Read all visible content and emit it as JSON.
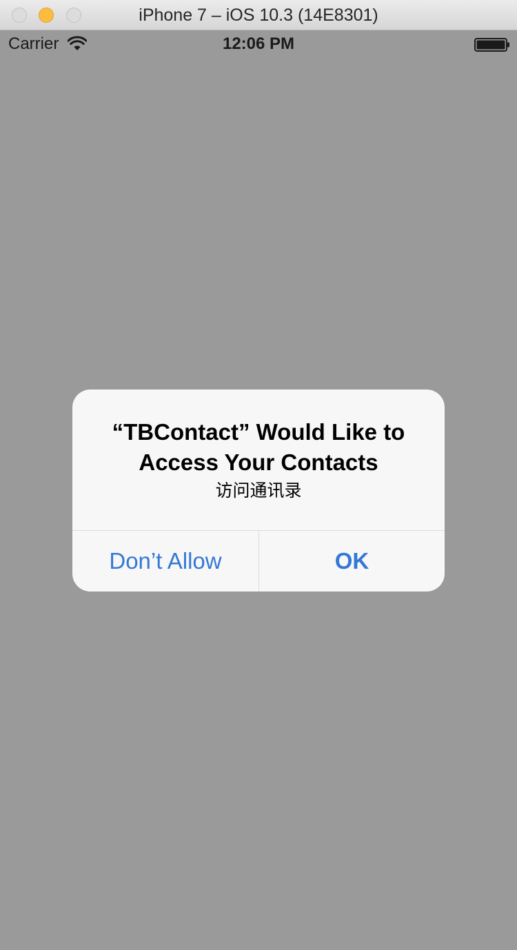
{
  "window": {
    "title": "iPhone 7 – iOS 10.3 (14E8301)"
  },
  "status_bar": {
    "carrier": "Carrier",
    "time": "12:06 PM",
    "wifi_icon": "wifi-icon",
    "battery_icon": "battery-icon"
  },
  "alert": {
    "title": "“TBContact” Would Like to Access Your Contacts",
    "message": "访问通讯录",
    "buttons": {
      "dont_allow": "Don’t Allow",
      "ok": "OK"
    }
  },
  "colors": {
    "background": "#9a9a9a",
    "alert_background": "#f7f7f7",
    "button_text": "#3478d6",
    "minimize_button": "#fdbc40"
  }
}
